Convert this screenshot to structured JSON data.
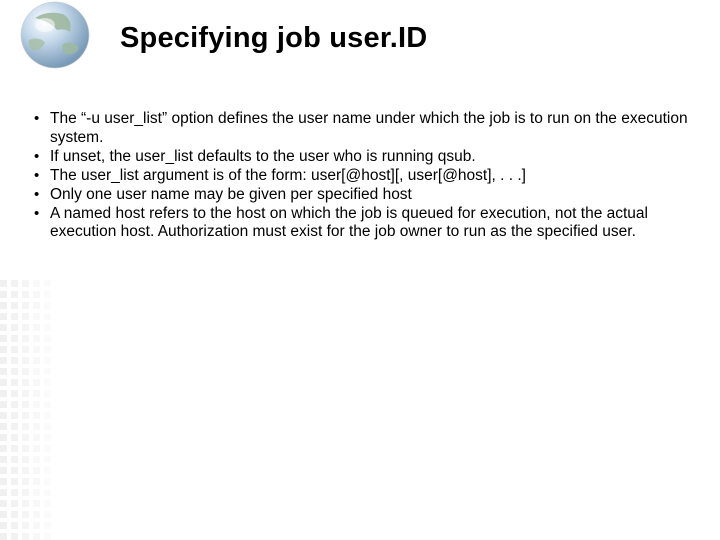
{
  "title": "Specifying job user.ID",
  "bullets": [
    "The “-u user_list” option defines the user name under which the job is to run on the execution system.",
    "If unset, the user_list defaults to the user who is running qsub.",
    "The user_list argument is of the form: user[@host][, user[@host], . . .]",
    "Only one user name may be given per specified host",
    "A named host refers to the host on which the job is queued for execution, not the actual execution host. Authorization must exist for the job owner to run as the specified user."
  ]
}
